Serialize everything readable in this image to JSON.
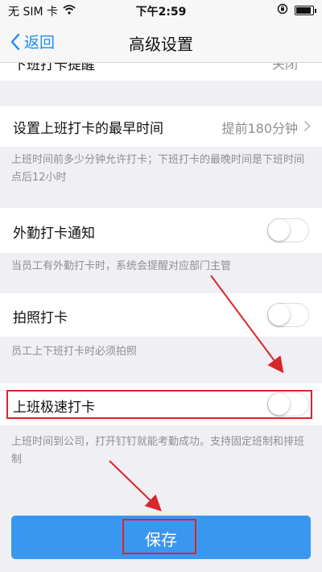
{
  "status_bar": {
    "carrier": "无 SIM 卡",
    "time": "下午2:59",
    "icons": [
      "wifi-icon",
      "orientation-lock-icon",
      "battery-icon"
    ]
  },
  "nav": {
    "back_label": "返回",
    "title": "高级设置"
  },
  "partial_row": {
    "label": "下班打卡提醒",
    "value": "关闭"
  },
  "settings": {
    "earliest_time": {
      "label": "设置上班打卡的最早时间",
      "value": "提前180分钟",
      "description": "上班时间前多少分钟允许打卡；下班打卡的最晚时间是下班时间点后12小时"
    },
    "outside_notice": {
      "label": "外勤打卡通知",
      "description": "当员工有外勤打卡时，系统会提醒对应部门主管",
      "enabled": false
    },
    "photo_checkin": {
      "label": "拍照打卡",
      "description": "员工上下班打卡时必须拍照",
      "enabled": false
    },
    "fast_checkin": {
      "label": "上班极速打卡",
      "description": "上班时间到公司，打开钉钉就能考勤成功。支持固定班制和排班制",
      "enabled": false
    }
  },
  "footer": {
    "save_label": "保存"
  },
  "colors": {
    "accent": "#1a8cff",
    "button": "#3a97f0",
    "annotation": "#d9262b",
    "background": "#efeff4"
  }
}
